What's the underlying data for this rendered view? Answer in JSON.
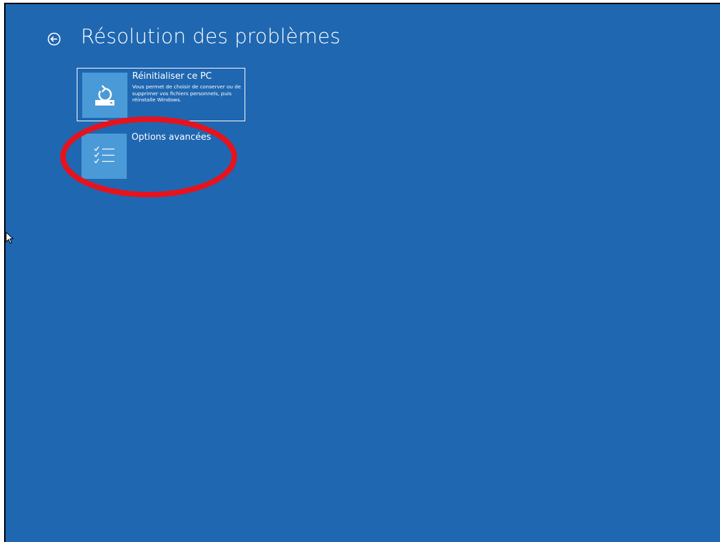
{
  "header": {
    "back_icon": "back-arrow-circle-icon",
    "title": "Résolution des problèmes"
  },
  "options": [
    {
      "icon": "reset-pc-icon",
      "title": "Réinitialiser ce PC",
      "description": "Vous permet de choisir de conserver ou de supprimer vos fichiers personnels, puis réinstalle Windows."
    },
    {
      "icon": "checklist-icon",
      "title": "Options avancées"
    }
  ],
  "colors": {
    "background": "#1f67b1",
    "tile_icon": "#4a9ad8",
    "text": "#ffffff",
    "annotation": "#e8121c"
  }
}
